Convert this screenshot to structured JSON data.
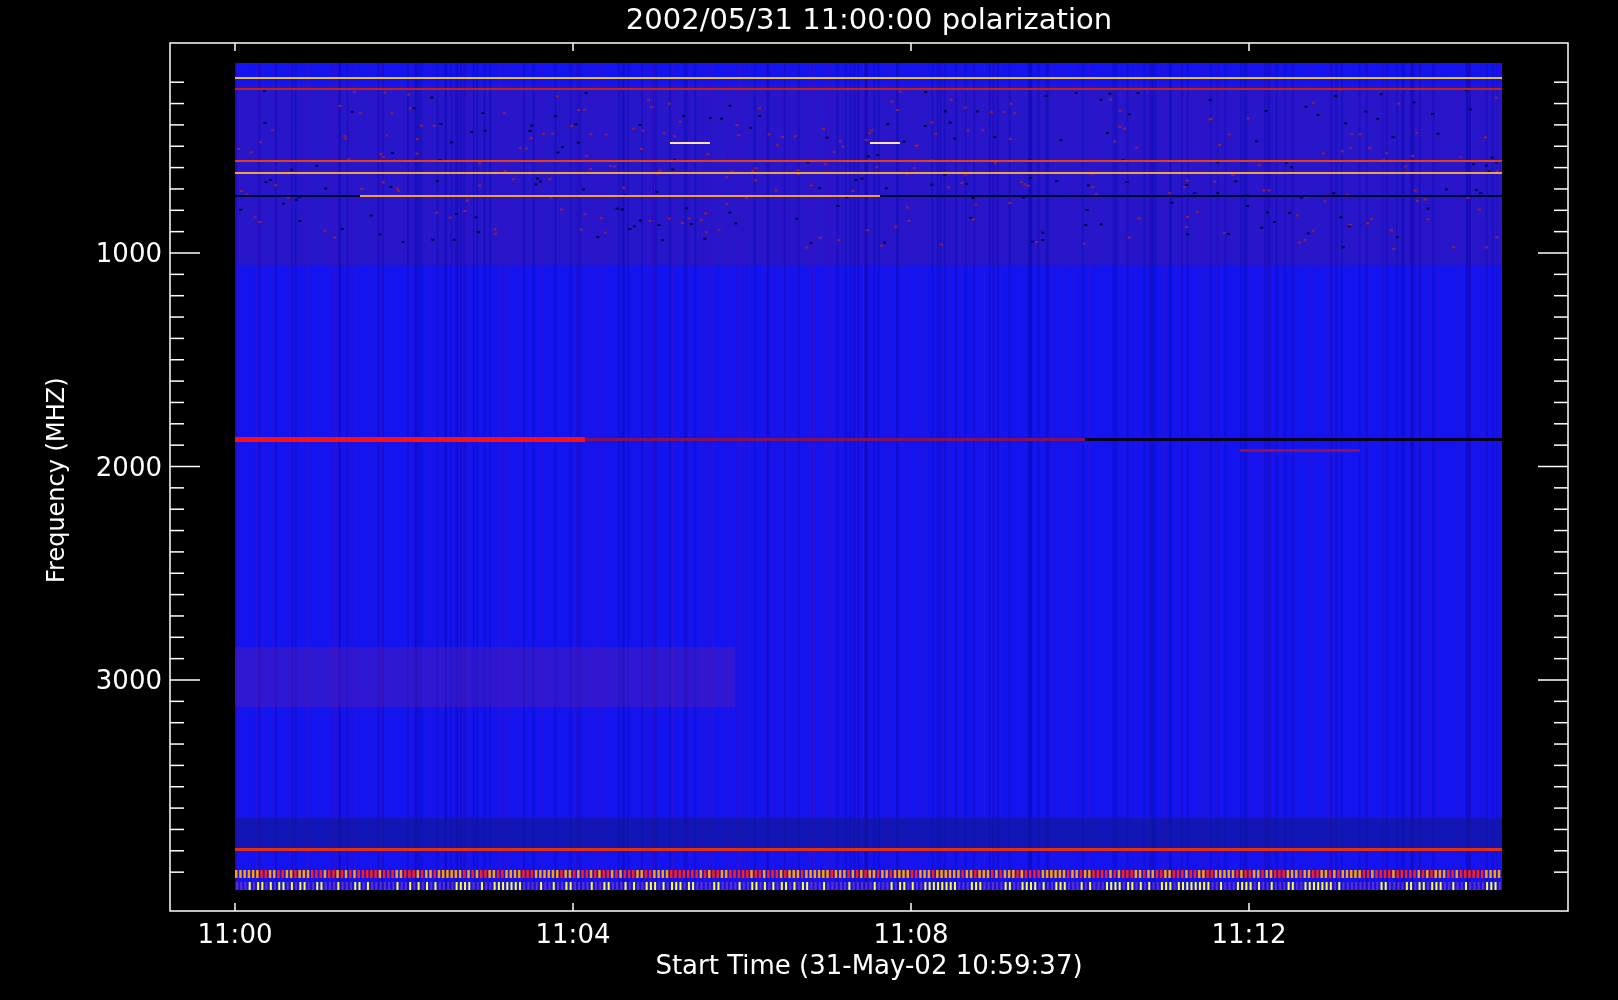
{
  "title": "2002/05/31 11:00:00 polarization",
  "ylabel": "Frequency (MHZ)",
  "yticks": [
    "1000",
    "2000",
    "3000"
  ],
  "xticks": [
    "11:00",
    "11:04",
    "11:08",
    "11:12"
  ],
  "xlabel": "Start Time (31-May-02 10:59:37)"
}
